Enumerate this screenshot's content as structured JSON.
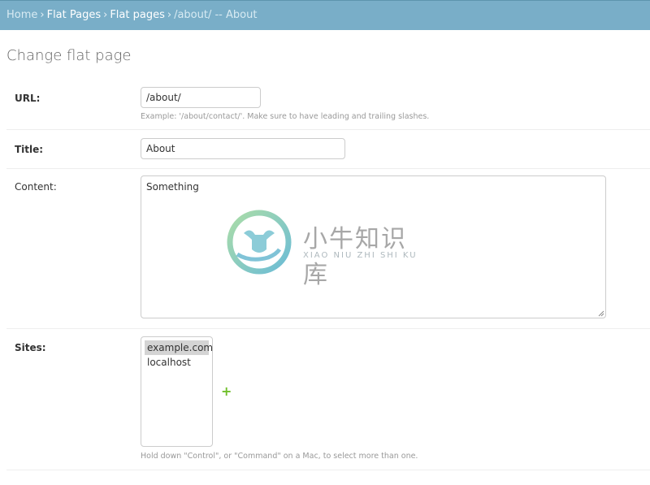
{
  "breadcrumbs": {
    "home": "Home",
    "app": "Flat Pages",
    "model": "Flat pages",
    "current": "/about/ -- About"
  },
  "page": {
    "title": "Change flat page"
  },
  "form": {
    "url": {
      "label": "URL:",
      "value": "/about/",
      "help": "Example: '/about/contact/'. Make sure to have leading and trailing slashes."
    },
    "title": {
      "label": "Title:",
      "value": "About"
    },
    "content": {
      "label": "Content:",
      "value": "Something"
    },
    "sites": {
      "label": "Sites:",
      "options": [
        "example.com",
        "localhost"
      ],
      "selected": "example.com",
      "add_icon": "plus-icon",
      "add_label": "+",
      "help": "Hold down \"Control\", or \"Command\" on a Mac, to select more than one."
    }
  },
  "watermark": {
    "chinese": "小牛知识库",
    "english": "XIAO NIU ZHI SHI KU"
  },
  "colors": {
    "header_bg": "#79aec8",
    "add_green": "#70bf2b",
    "selected_bg": "#d4d4d4"
  }
}
